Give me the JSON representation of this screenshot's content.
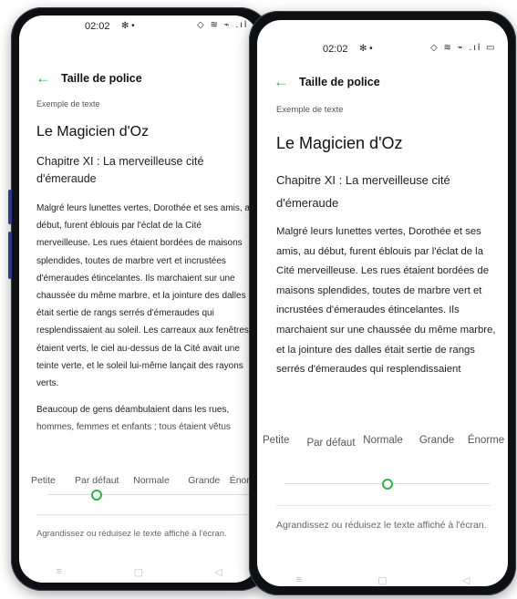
{
  "status": {
    "time": "02:02",
    "extras": "✻ •",
    "icons": "◇ ≋ ⌁ .ıl ▭"
  },
  "header": {
    "title": "Taille de police"
  },
  "sample_label": "Exemple de texte",
  "book_title": "Le Magicien d'Oz",
  "chapter": "Chapitre XI : La merveilleuse cité d'émeraude",
  "back": {
    "paragraph1": "Malgré leurs lunettes vertes, Dorothée et ses amis, au début, furent éblouis par l'éclat de la Cité merveilleuse. Les rues étaient bordées de maisons splendides, toutes de marbre vert et incrustées d'émeraudes étincelantes. Ils marchaient sur une chaussée du même marbre, et la jointure des dalles était sertie de rangs serrés d'émeraudes qui resplendissaient au soleil. Les carreaux aux fenêtres étaient verts, le ciel au-dessus de la Cité avait une teinte verte, et le soleil lui-même lançait des rayons verts.",
    "paragraph2": "Beaucoup de gens déambulaient dans les rues, hommes, femmes et enfants ; tous étaient vêtus",
    "sizes": [
      "Petite",
      "Par défaut",
      "Normale",
      "Grande",
      "Énorme"
    ],
    "selected_index": 1,
    "hint": "Agrandissez ou réduisez le texte affiché à l'écran."
  },
  "front": {
    "paragraph1": "Malgré leurs lunettes vertes, Dorothée et ses amis, au début, furent éblouis par l'éclat de la Cité merveilleuse. Les rues étaient bordées de maisons splendides, toutes de marbre vert et incrustées d'émeraudes étincelantes. Ils marchaient sur une chaussée du même marbre, et la jointure des dalles était sertie de rangs serrés d'émeraudes qui resplendissaient",
    "sizes": [
      "Petite",
      "Par défaut",
      "Normale",
      "Grande",
      "Énorme"
    ],
    "selected_index": 2,
    "hint": "Agrandissez ou réduisez le texte affiché à l'écran."
  },
  "nav": {
    "menu": "≡",
    "home": "▢",
    "back": "◁"
  },
  "colors": {
    "accent": "#2db34a",
    "frame": "#0e1014",
    "side_button": "#2b3a8f"
  }
}
